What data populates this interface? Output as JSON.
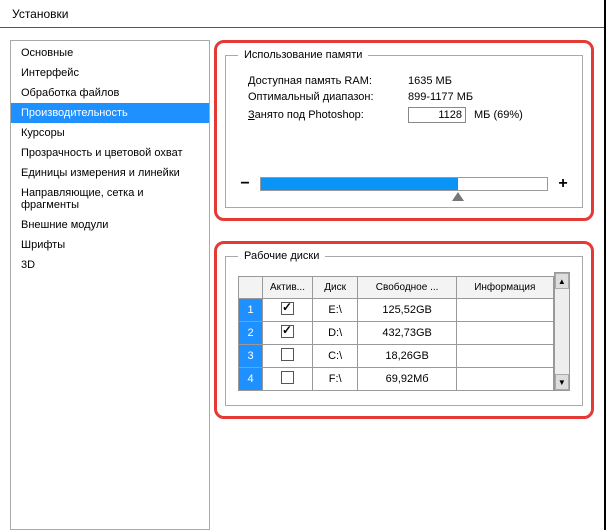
{
  "window": {
    "title": "Установки"
  },
  "sidebar": {
    "items": [
      {
        "label": "Основные"
      },
      {
        "label": "Интерфейс"
      },
      {
        "label": "Обработка файлов"
      },
      {
        "label": "Производительность",
        "selected": true
      },
      {
        "label": "Курсоры"
      },
      {
        "label": "Прозрачность и цветовой охват"
      },
      {
        "label": "Единицы измерения и линейки"
      },
      {
        "label": "Направляющие, сетка и фрагменты"
      },
      {
        "label": "Внешние модули"
      },
      {
        "label": "Шрифты"
      },
      {
        "label": "3D"
      }
    ]
  },
  "memory": {
    "legend": "Использование памяти",
    "available_label": "Доступная память RAM:",
    "available_value": "1635 МБ",
    "optimal_label": "Оптимальный диапазон:",
    "optimal_value": "899-1177 МБ",
    "used_label_prefix": "З",
    "used_label_rest": "анято под Photoshop:",
    "used_value": "1128",
    "used_unit": "МБ (69%)",
    "slider_percent": 69,
    "minus": "−",
    "plus": "+"
  },
  "disks": {
    "legend": "Рабочие диски",
    "headers": {
      "blank": "",
      "active": "Актив...",
      "disk": "Диск",
      "free": "Свободное ...",
      "info": "Информация"
    },
    "rows": [
      {
        "idx": "1",
        "active": true,
        "disk": "E:\\",
        "free": "125,52GB",
        "info": ""
      },
      {
        "idx": "2",
        "active": true,
        "disk": "D:\\",
        "free": "432,73GB",
        "info": ""
      },
      {
        "idx": "3",
        "active": false,
        "disk": "C:\\",
        "free": "18,26GB",
        "info": ""
      },
      {
        "idx": "4",
        "active": false,
        "disk": "F:\\",
        "free": "69,92Мб",
        "info": ""
      }
    ]
  },
  "scroll": {
    "up": "▲",
    "down": "▼"
  }
}
